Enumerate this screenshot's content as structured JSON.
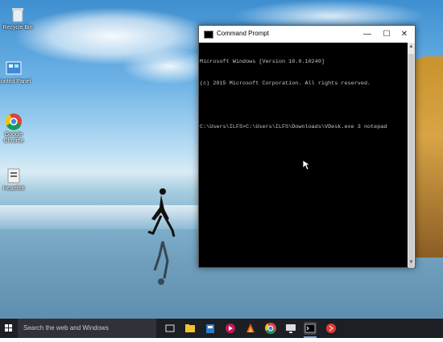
{
  "desktop": {
    "icons": [
      {
        "label": "Recycle Bin",
        "icon": "recycle-bin-icon"
      },
      {
        "label": "Control Panel",
        "icon": "control-panel-icon"
      },
      {
        "label": "Google Chrome",
        "icon": "chrome-icon"
      },
      {
        "label": "Heartfelt",
        "icon": "folder-icon"
      }
    ]
  },
  "window": {
    "title": "Command Prompt",
    "controls": {
      "minimize": "—",
      "maximize": "☐",
      "close": "✕"
    },
    "console_lines": [
      "Microsoft Windows [Version 10.0.10240]",
      "(c) 2015 Microsoft Corporation. All rights reserved.",
      "",
      "C:\\Users\\ILFS>C:\\Users\\ILFS\\Downloads\\VDesk.exe 3 notepad"
    ]
  },
  "taskbar": {
    "search_placeholder": "Search the web and Windows",
    "apps": [
      "task-view-icon",
      "file-explorer-icon",
      "store-icon",
      "media-icon",
      "game-icon",
      "chrome-icon",
      "desktop-icon",
      "cmd-icon",
      "red-app-icon"
    ]
  },
  "colors": {
    "console_bg": "#000000",
    "console_text": "#c8c8c8",
    "taskbar": "#1c1f24",
    "accent": "#7aa8d9"
  }
}
